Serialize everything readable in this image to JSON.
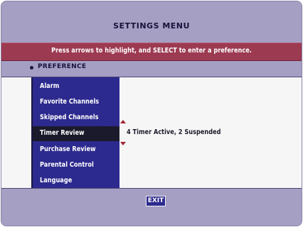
{
  "title": "SETTINGS MENU",
  "instruction": "Press arrows to highlight, and SELECT to enter a preference.",
  "section_label": "PREFERENCE",
  "menu": {
    "items": [
      {
        "label": "Alarm",
        "selected": false
      },
      {
        "label": "Favorite Channels",
        "selected": false
      },
      {
        "label": "Skipped Channels",
        "selected": false
      },
      {
        "label": "Timer Review",
        "selected": true
      },
      {
        "label": "Purchase Review",
        "selected": false
      },
      {
        "label": "Parental Control",
        "selected": false
      },
      {
        "label": "Language",
        "selected": false
      }
    ]
  },
  "selected_value": "4 Timer Active, 2 Suspended",
  "exit_label": "EXIT",
  "colors": {
    "background": "#a59fc4",
    "instruction_bar": "#9c3a52",
    "menu": "#2c2a8e",
    "menu_selected": "#1b1a2c",
    "content": "#f7f6f6"
  }
}
